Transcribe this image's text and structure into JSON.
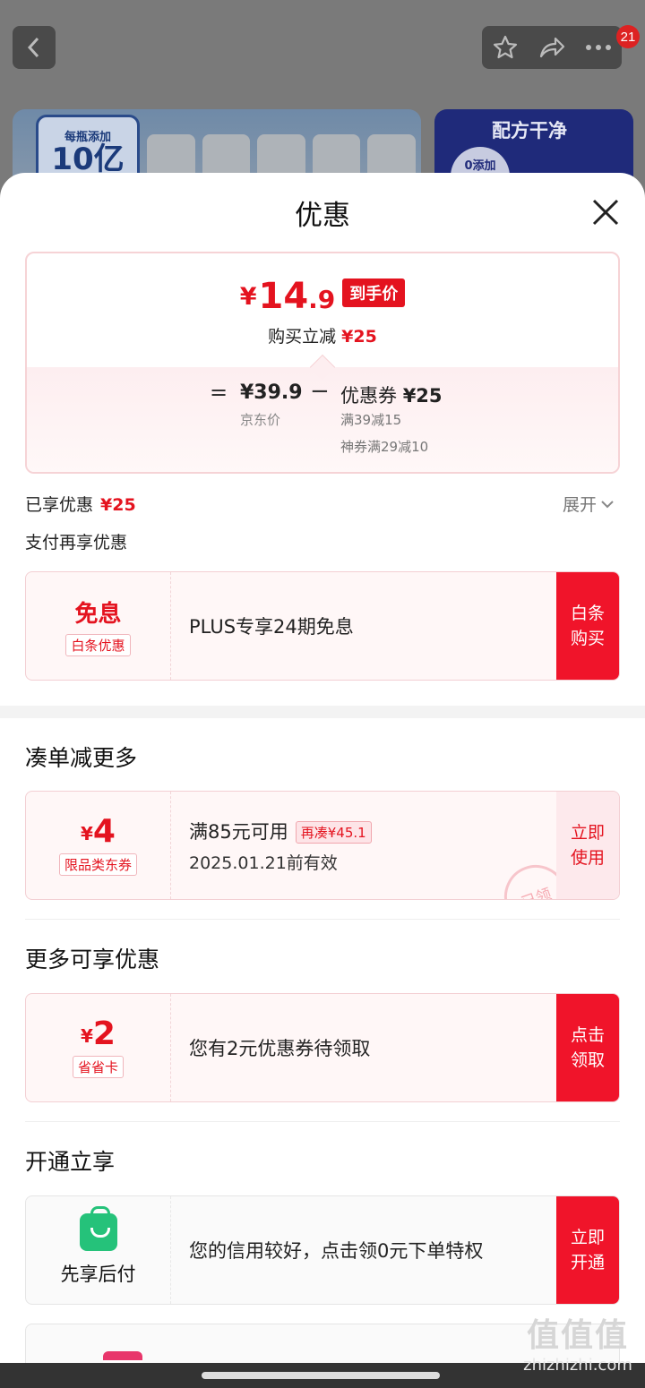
{
  "background": {
    "notification_count": "21",
    "banner_left_small": "每瓶添加",
    "banner_left_big": "10亿",
    "banner_right_title": "配方干净",
    "banner_right_tag": "0添加"
  },
  "sheet": {
    "title": "优惠"
  },
  "price_summary": {
    "currency": "¥",
    "final_int": "14",
    "final_dec": ".9",
    "final_tag": "到手价",
    "save_label": "购买立减",
    "save_amount": "¥25",
    "equals": "=",
    "jd_price": "¥39.9",
    "jd_label": "京东价",
    "minus": "−",
    "coupon_label": "优惠券",
    "coupon_amount": "¥25",
    "coupon_rule1": "满39减15",
    "coupon_rule2": "神券满29减10"
  },
  "enjoyed": {
    "label": "已享优惠",
    "amount": "¥25",
    "expand": "展开"
  },
  "pay_more": {
    "label": "支付再享优惠"
  },
  "baitiao": {
    "title": "免息",
    "tag": "白条优惠",
    "desc": "PLUS专享24期免息",
    "button": "白条购买"
  },
  "more_section": {
    "title": "凑单减更多"
  },
  "jd_coupon": {
    "currency": "¥",
    "amount": "4",
    "tag": "限品类东券",
    "condition": "满85元可用",
    "pill": "再凑¥45.1",
    "expiry": "2025.01.21前有效",
    "button": "立即使用",
    "stamp": "已领"
  },
  "extra_section": {
    "title": "更多可享优惠"
  },
  "saver_card": {
    "currency": "¥",
    "amount": "2",
    "tag": "省省卡",
    "desc": "您有2元优惠券待领取",
    "button": "点击领取"
  },
  "open_section": {
    "title": "开通立享"
  },
  "pay_later": {
    "label": "先享后付",
    "desc": "您的信用较好，点击领0元下单特权",
    "button": "立即开通"
  },
  "watermark": {
    "top": "值值值",
    "bottom": "zhizhizhi.com"
  },
  "colors": {
    "accent_red": "#e4131f",
    "button_red": "#f0142a",
    "pay_later_green": "#25c27a"
  }
}
